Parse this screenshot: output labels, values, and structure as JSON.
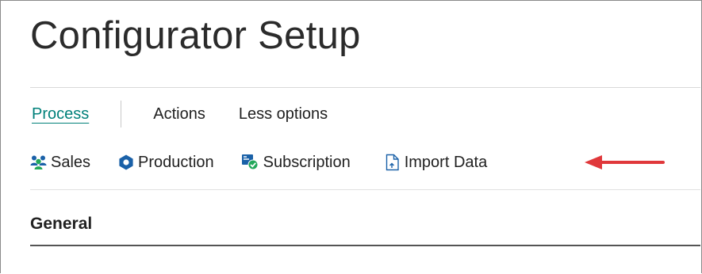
{
  "page": {
    "title": "Configurator Setup"
  },
  "tabs": [
    {
      "label": "Process",
      "active": true
    },
    {
      "label": "Actions",
      "active": false
    },
    {
      "label": "Less options",
      "active": false
    }
  ],
  "actions": [
    {
      "label": "Sales",
      "icon": "people-icon"
    },
    {
      "label": "Production",
      "icon": "hexagon-icon"
    },
    {
      "label": "Subscription",
      "icon": "subscription-icon"
    },
    {
      "label": "Import Data",
      "icon": "import-document-icon"
    }
  ],
  "section": {
    "title": "General"
  },
  "annotation": {
    "icon": "red-arrow-icon",
    "target": "Import Data"
  },
  "colors": {
    "accent": "#00807a",
    "arrow": "#e0383b",
    "icon_blue": "#1a61a8",
    "icon_green": "#23a85a"
  }
}
